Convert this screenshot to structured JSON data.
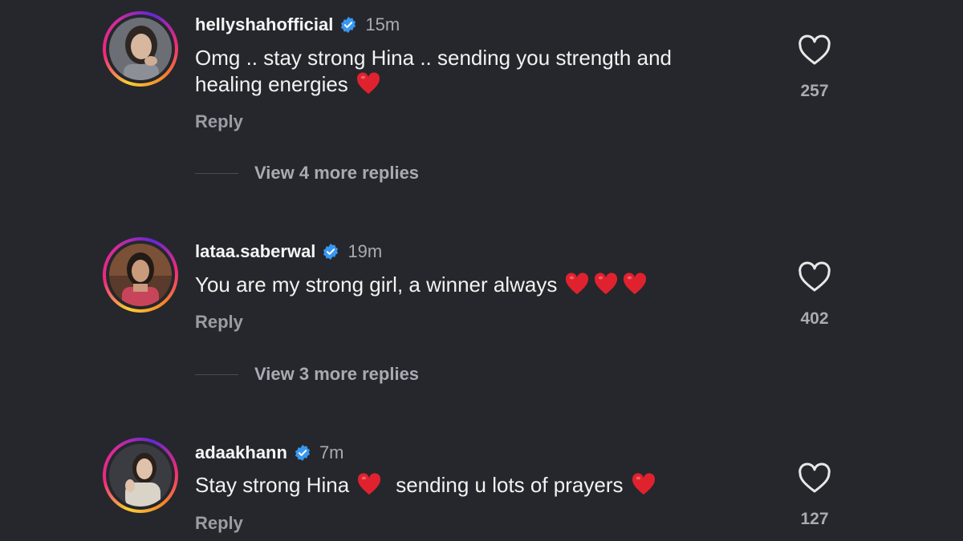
{
  "comments": [
    {
      "username": "hellyshahofficial",
      "verified": true,
      "time": "15m",
      "text_line1": "Omg .. stay strong Hina .. sending you strength and",
      "text_line2": "healing energies",
      "hearts_after_line2": 1,
      "reply_label": "Reply",
      "likes": "257",
      "view_replies": "View 4 more replies",
      "avatar": "hellyshah-avatar"
    },
    {
      "username": "lataa.saberwal",
      "verified": true,
      "time": "19m",
      "text": "You are my strong girl, a winner always",
      "hearts_after_text": 3,
      "reply_label": "Reply",
      "likes": "402",
      "view_replies": "View 3 more replies",
      "avatar": "lataa-avatar"
    },
    {
      "username": "adaakhann",
      "verified": true,
      "time": "7m",
      "text_part1": "Stay strong Hina",
      "text_part2": "sending u lots of prayers",
      "reply_label": "Reply",
      "likes": "127",
      "avatar": "adaakhann-avatar"
    }
  ],
  "colors": {
    "background": "#25272c",
    "verified_blue": "#3897f0",
    "heart_red": "#e0222e"
  },
  "icons": {
    "verified": "verified-badge-icon",
    "like": "heart-outline-icon",
    "emoji": "red-heart-emoji"
  }
}
